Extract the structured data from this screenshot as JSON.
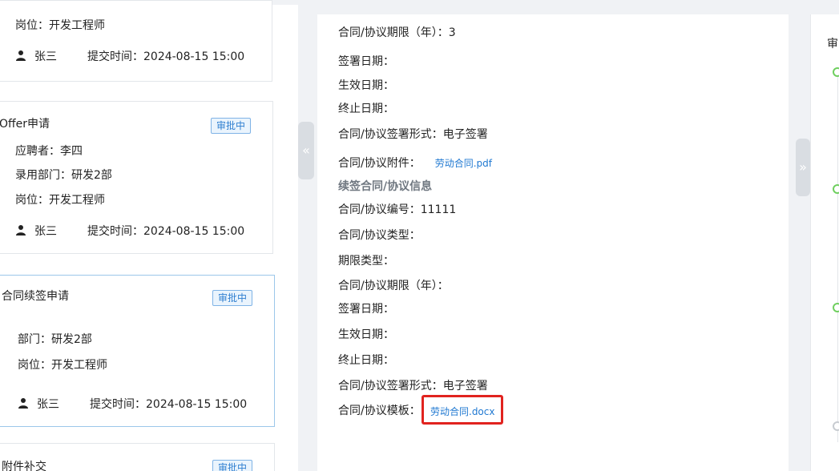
{
  "cards": [
    {
      "fields": [
        "岗位：开发工程师"
      ],
      "user": "张三",
      "submit_time": "提交时间：2024-08-15 15:00"
    },
    {
      "title": "Offer申请",
      "badge": "审批中",
      "fields": [
        "应聘者：李四",
        "录用部门：研发2部",
        "岗位：开发工程师"
      ],
      "user": "张三",
      "submit_time": "提交时间：2024-08-15 15:00"
    },
    {
      "title": "合同续签申请",
      "badge": "审批中",
      "fields": [
        "部门：研发2部",
        "岗位：开发工程师"
      ],
      "user": "张三",
      "submit_time": "提交时间：2024-08-15 15:00"
    },
    {
      "title": "附件补交",
      "badge": "审批中"
    }
  ],
  "handles": {
    "left": "«",
    "right": "»"
  },
  "detail": {
    "lines": [
      "合同/协议期限（年）：3",
      "签署日期：",
      "生效日期：",
      "终止日期：",
      "合同/协议签署形式：电子签署"
    ],
    "attachment_label": "合同/协议附件：",
    "attachment_link": "劳动合同.pdf",
    "renewal_section_title": "续签合同/协议信息",
    "renewal_lines": [
      "合同/协议编号：11111",
      "合同/协议类型：",
      "期限类型：",
      "合同/协议期限（年）：",
      "签署日期：",
      "生效日期：",
      "终止日期：",
      "合同/协议签署形式：电子签署"
    ],
    "template_label": "合同/协议模板：",
    "template_link": "劳动合同.docx"
  },
  "right_panel": {
    "title": "审"
  },
  "colors": {
    "link": "#1f78d1",
    "highlight": "#e1231f",
    "badge": "#2f7fd0",
    "timeline_active": "#6fcf5f"
  }
}
